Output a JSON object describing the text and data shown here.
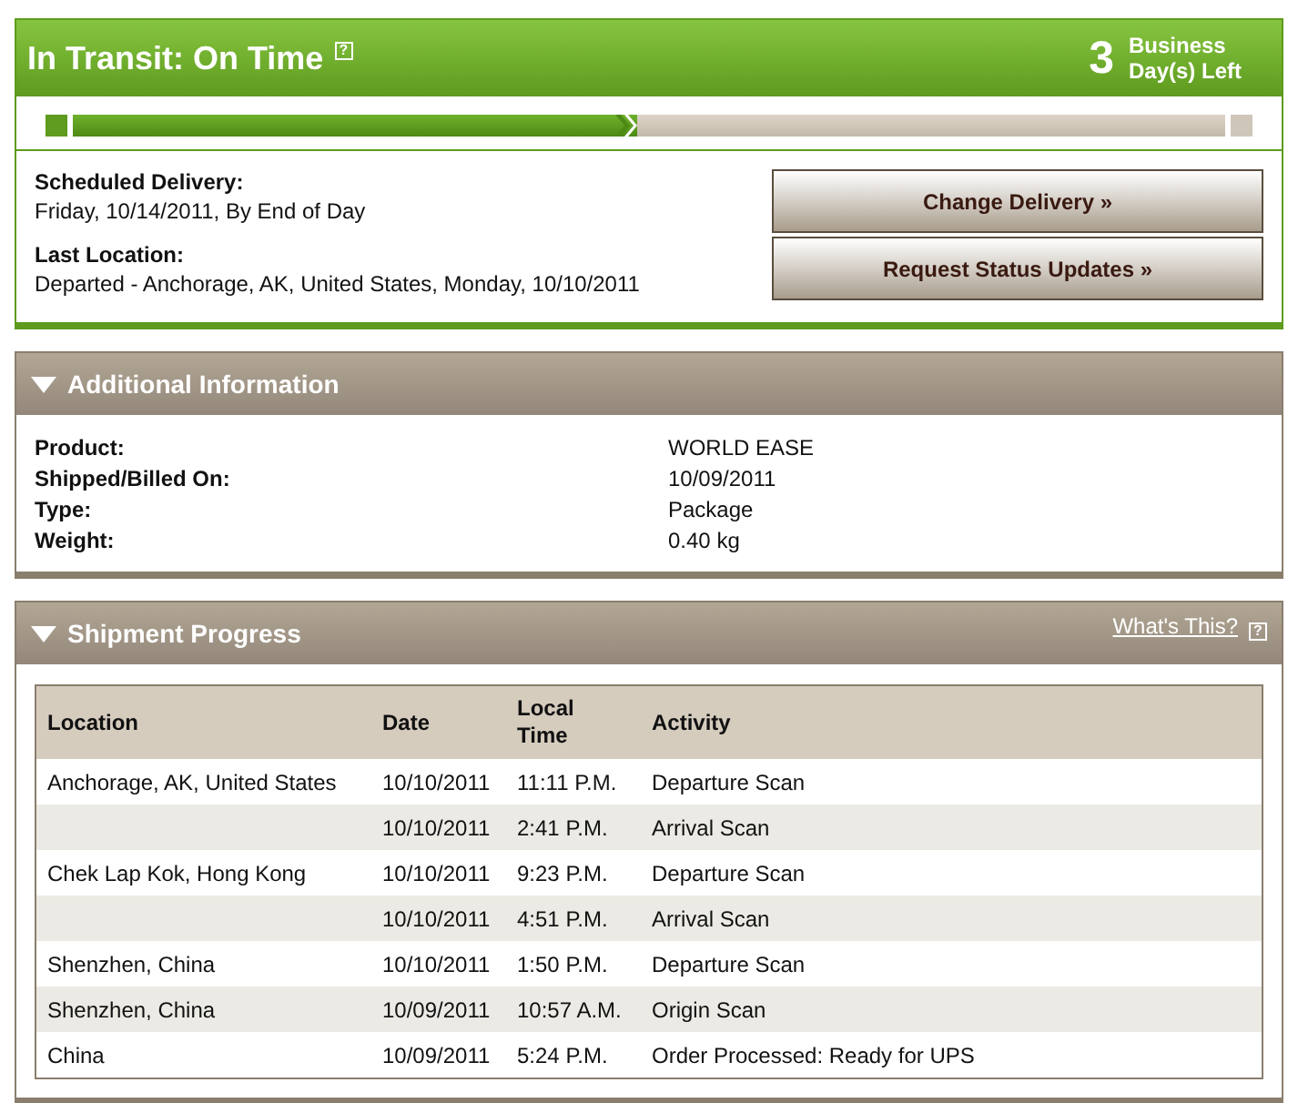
{
  "status": {
    "title": "In Transit: On Time",
    "help_icon": "?",
    "days_count": "3",
    "days_label": "Business Day(s) Left",
    "progress": {
      "level": 0.49
    }
  },
  "delivery": {
    "scheduled_label": "Scheduled Delivery:",
    "scheduled_value": "Friday, 10/14/2011, By End of Day",
    "location_label": "Last Location:",
    "location_value": "Departed - Anchorage, AK, United States, Monday, 10/10/2011"
  },
  "buttons": [
    "Change Delivery »",
    "Request Status Updates »"
  ],
  "additional_info": {
    "title": "Additional Information",
    "expanded": true,
    "rows": [
      {
        "label": "Product:",
        "value": "WORLD EASE"
      },
      {
        "label": "Shipped/Billed On:",
        "value": "10/09/2011"
      },
      {
        "label": "Type:",
        "value": "Package"
      },
      {
        "label": "Weight:",
        "value": "0.40 kg"
      }
    ]
  },
  "shipment_progress": {
    "title": "Shipment Progress",
    "expanded": true,
    "link": "What's This?",
    "help_icon": "?",
    "columns": [
      "Location",
      "Date",
      "Local Time",
      "Activity"
    ],
    "rows": [
      [
        "Anchorage, AK, United States",
        "10/10/2011",
        "11:11 P.M.",
        "Departure Scan"
      ],
      [
        "",
        "10/10/2011",
        "2:41 P.M.",
        "Arrival Scan"
      ],
      [
        "Chek Lap Kok, Hong Kong",
        "10/10/2011",
        "9:23 P.M.",
        "Departure Scan"
      ],
      [
        "",
        "10/10/2011",
        "4:51 P.M.",
        "Arrival Scan"
      ],
      [
        "Shenzhen, China",
        "10/10/2011",
        "1:50 P.M.",
        "Departure Scan"
      ],
      [
        "Shenzhen, China",
        "10/09/2011",
        "10:57 A.M.",
        "Origin Scan"
      ],
      [
        "China",
        "10/09/2011",
        "5:24 P.M.",
        "Order Processed: Ready for UPS"
      ]
    ]
  }
}
